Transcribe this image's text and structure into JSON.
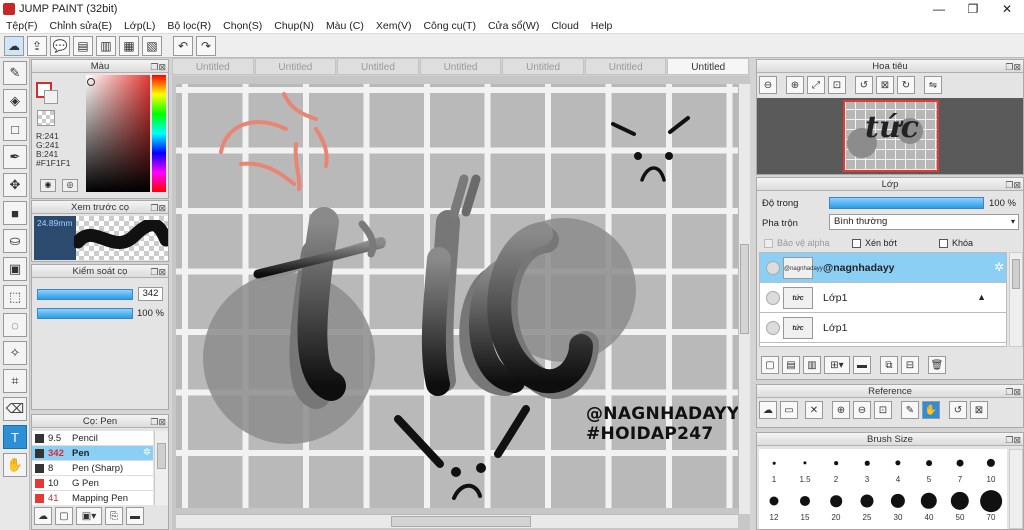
{
  "window": {
    "title": "JUMP PAINT (32bit)",
    "minimize": "—",
    "maximize": "❐",
    "close": "✕"
  },
  "menu": [
    "Tệp(F)",
    "Chỉnh sửa(E)",
    "Lớp(L)",
    "Bộ lọc(R)",
    "Chọn(S)",
    "Chụp(N)",
    "Màu (C)",
    "Xem(V)",
    "Công cụ(T)",
    "Cửa sổ(W)",
    "Cloud",
    "Help"
  ],
  "color_panel": {
    "title": "Màu",
    "r": "R:241",
    "g": "G:241",
    "b": "B:241",
    "hex": "#F1F1F1"
  },
  "brush_preview": {
    "title": "Xem trước cọ",
    "size": "24.89mm"
  },
  "brush_control": {
    "title": "Kiểm soát cọ",
    "size_value": "342",
    "opacity_value": "100 %"
  },
  "brush_list": {
    "title": "Cọ: Pen",
    "items": [
      {
        "size": "9.5",
        "name": "Pencil"
      },
      {
        "size": "342",
        "name": "Pen"
      },
      {
        "size": "8",
        "name": "Pen (Sharp)"
      },
      {
        "size": "10",
        "name": "G Pen"
      },
      {
        "size": "41",
        "name": "Mapping Pen"
      }
    ]
  },
  "tabs": [
    "Untitled",
    "Untitled",
    "Untitled",
    "Untitled",
    "Untitled",
    "Untitled",
    "Untitled"
  ],
  "artwork": {
    "main_word": "tức",
    "handle": "@NAGNHADAYY",
    "hashtag": "#HOIDAP247"
  },
  "navigator": {
    "title": "Hoa tiêu",
    "thumb_text": "tức"
  },
  "layers": {
    "title": "Lớp",
    "opacity_label": "Độ trong",
    "opacity_value": "100 %",
    "blend_label": "Pha trộn",
    "blend_value": "Bình thường",
    "protect_alpha": "Bảo vệ alpha",
    "clipping": "Xén bớt",
    "lock": "Khóa",
    "rows": [
      {
        "name": "@nagnhadayy",
        "thumb": "@nagnhadayy"
      },
      {
        "name": "Lớp1",
        "thumb": "tức"
      },
      {
        "name": "Lớp1",
        "thumb": "tức"
      }
    ]
  },
  "reference": {
    "title": "Reference"
  },
  "brush_size": {
    "title": "Brush Size",
    "row1": [
      "1",
      "1.5",
      "2",
      "3",
      "4",
      "5",
      "7",
      "10"
    ],
    "row2": [
      "12",
      "15",
      "20",
      "25",
      "30",
      "40",
      "50",
      "70"
    ]
  }
}
